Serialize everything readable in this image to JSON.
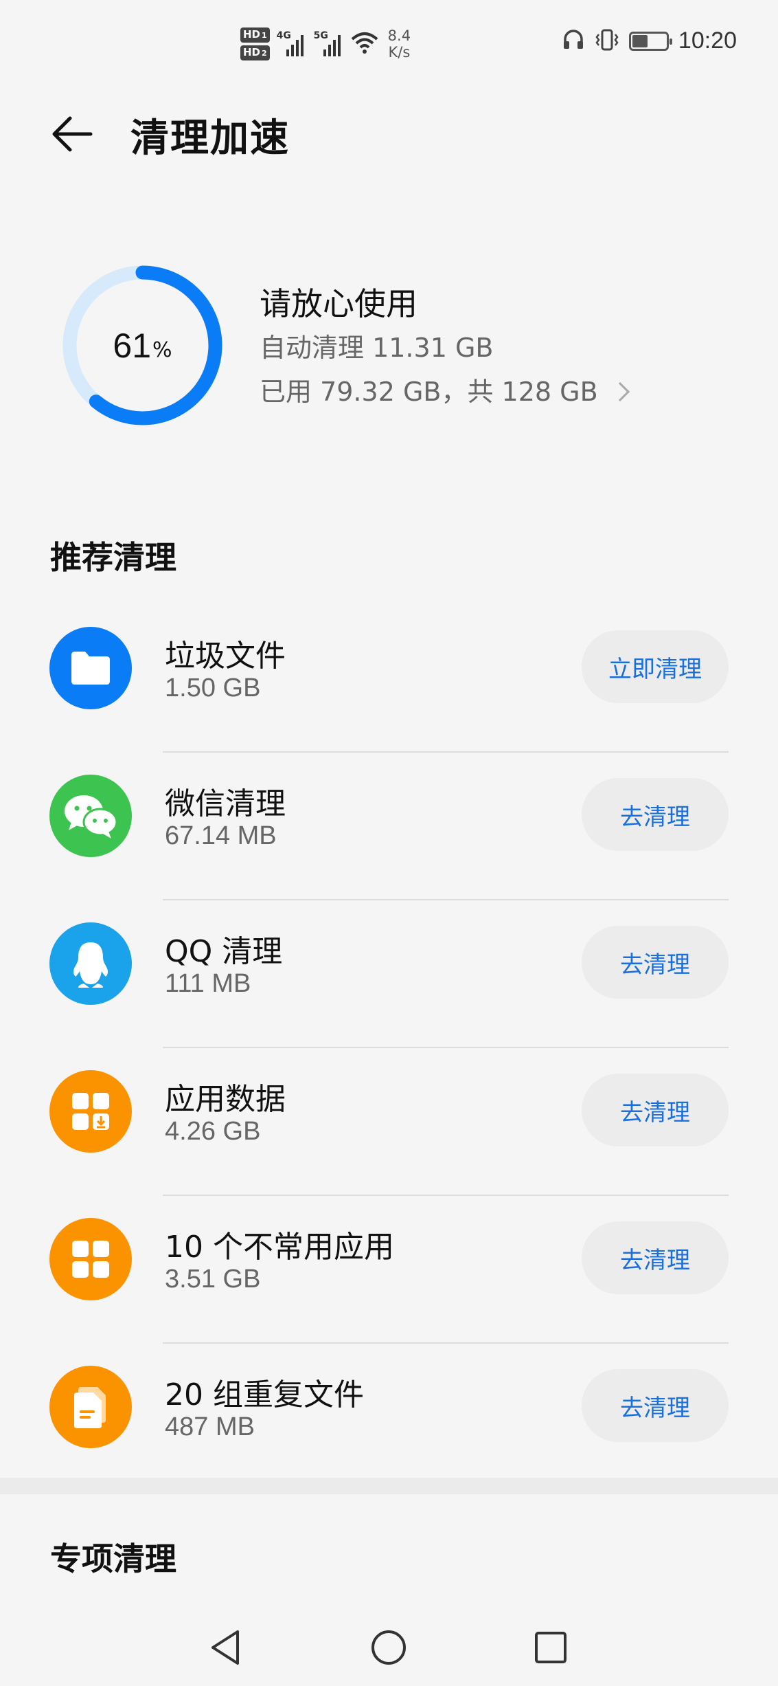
{
  "status_bar": {
    "hd1": "HD",
    "hd1_sub": "1",
    "hd2": "HD",
    "hd2_sub": "2",
    "net1": "4G",
    "net2": "5G",
    "speed_value": "8.4",
    "speed_unit": "K/s",
    "battery_level": 0.45,
    "time": "10:20",
    "icons": [
      "headphones-icon",
      "vibrate-icon",
      "battery-icon",
      "wifi-icon",
      "signal-icon"
    ]
  },
  "header": {
    "title": "清理加速"
  },
  "storage": {
    "percent": "61",
    "percent_sign": "%",
    "percent_value": 61,
    "status": "请放心使用",
    "auto_clean": "自动清理 11.31 GB",
    "used": "已用 79.32 GB，共 128 GB",
    "ring_color": "#0a7cf5",
    "ring_track_color": "#d6eafc"
  },
  "recommended": {
    "title": "推荐清理",
    "items": [
      {
        "name": "垃圾文件",
        "size": "1.50 GB",
        "button": "立即清理",
        "icon": "folder-icon",
        "color": "#0a7cf5"
      },
      {
        "name": "微信清理",
        "size": "67.14 MB",
        "button": "去清理",
        "icon": "wechat-icon",
        "color": "#3dc34f"
      },
      {
        "name": "QQ 清理",
        "size": "111 MB",
        "button": "去清理",
        "icon": "qq-penguin-icon",
        "color": "#1aa3ea"
      },
      {
        "name": "应用数据",
        "size": "4.26 GB",
        "button": "去清理",
        "icon": "app-data-icon",
        "color": "#fb9300"
      },
      {
        "name": "10 个不常用应用",
        "size": "3.51 GB",
        "button": "去清理",
        "icon": "apps-grid-icon",
        "color": "#fb9300"
      },
      {
        "name": "20 组重复文件",
        "size": "487 MB",
        "button": "去清理",
        "icon": "duplicate-files-icon",
        "color": "#fb9300"
      }
    ]
  },
  "special": {
    "title": "专项清理"
  }
}
